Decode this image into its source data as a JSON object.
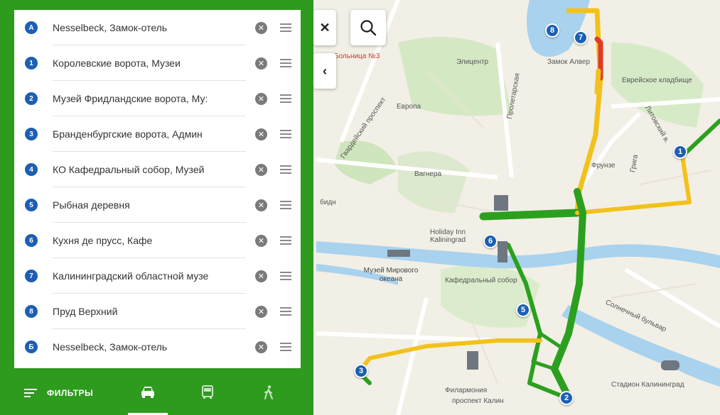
{
  "panel": {
    "waypoints": [
      {
        "badge": "A",
        "label": "Nesselbeck, Замок-отель"
      },
      {
        "badge": "1",
        "label": "Королевские ворота, Музеи"
      },
      {
        "badge": "2",
        "label": "Музей Фридландские ворота, Му:"
      },
      {
        "badge": "3",
        "label": "Бранденбургские ворота, Админ"
      },
      {
        "badge": "4",
        "label": "КО Кафедральный собор, Музей"
      },
      {
        "badge": "5",
        "label": "Рыбная деревня"
      },
      {
        "badge": "6",
        "label": "Кухня де прусс, Кафе"
      },
      {
        "badge": "7",
        "label": "Калининградский областной музе"
      },
      {
        "badge": "8",
        "label": "Пруд Верхний"
      },
      {
        "badge": "Б",
        "label": "Nesselbeck, Замок-отель"
      }
    ],
    "filters_label": "ФИЛЬТРЫ",
    "modes": [
      {
        "name": "car",
        "icon": "car-icon",
        "active": true
      },
      {
        "name": "bus",
        "icon": "bus-icon",
        "active": false
      },
      {
        "name": "walk",
        "icon": "walk-icon",
        "active": false
      }
    ]
  },
  "map": {
    "close_icon": "close-icon",
    "search_icon": "search-icon",
    "collapse_icon": "chevron-left-icon",
    "labels": {
      "hospital": "Больница №3",
      "elitsentr": "Элицентр",
      "evropa": "Европа",
      "gvardeysky": "Гвардейский проспект",
      "proletarskaya": "Пролетарская",
      "zamok": "Замок Алвер",
      "cemetery": "Еврейское кладбище",
      "litovsky": "Литовский в.",
      "wagnera": "Вагнера",
      "frunze": "Фрунзе",
      "gregra": "Грига",
      "bidy": "бидн",
      "holiday_inn": "Holiday Inn Kaliningrad",
      "museum_ocean": "Музей Мирового океана",
      "cathedral": "Кафедральный собор",
      "solnechny": "Солнечный бульвар",
      "philharmonic": "Филармония",
      "prospekt": "проспект Калин",
      "stadium": "Стадион Калининград"
    },
    "pins": [
      "1",
      "2",
      "3",
      "5",
      "6",
      "7",
      "8"
    ]
  },
  "colors": {
    "panel_green": "#2e9a1e",
    "pin_blue": "#1c5fb4",
    "route_green": "#2ba01f",
    "route_yellow": "#f2c21b",
    "route_red": "#e03a2a",
    "water": "#a8d2ee"
  }
}
